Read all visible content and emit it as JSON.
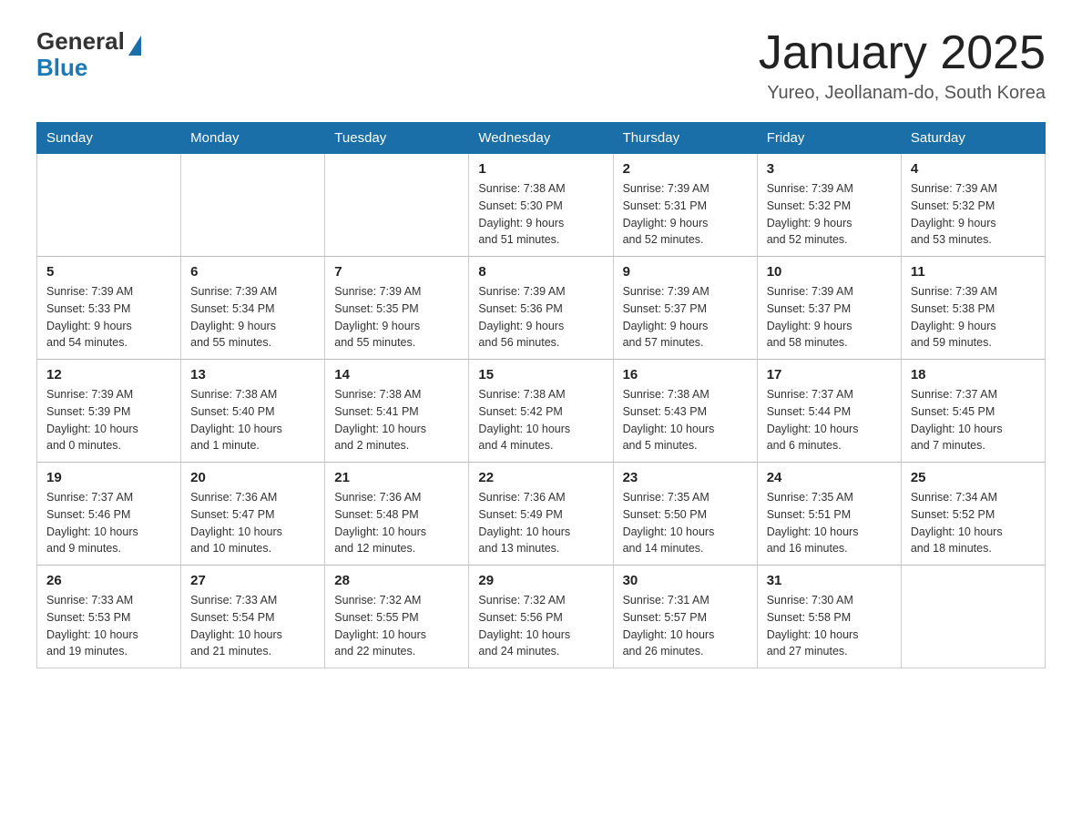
{
  "header": {
    "logo_general": "General",
    "logo_blue": "Blue",
    "title": "January 2025",
    "subtitle": "Yureo, Jeollanam-do, South Korea"
  },
  "weekdays": [
    "Sunday",
    "Monday",
    "Tuesday",
    "Wednesday",
    "Thursday",
    "Friday",
    "Saturday"
  ],
  "weeks": [
    [
      {
        "day": "",
        "info": ""
      },
      {
        "day": "",
        "info": ""
      },
      {
        "day": "",
        "info": ""
      },
      {
        "day": "1",
        "info": "Sunrise: 7:38 AM\nSunset: 5:30 PM\nDaylight: 9 hours\nand 51 minutes."
      },
      {
        "day": "2",
        "info": "Sunrise: 7:39 AM\nSunset: 5:31 PM\nDaylight: 9 hours\nand 52 minutes."
      },
      {
        "day": "3",
        "info": "Sunrise: 7:39 AM\nSunset: 5:32 PM\nDaylight: 9 hours\nand 52 minutes."
      },
      {
        "day": "4",
        "info": "Sunrise: 7:39 AM\nSunset: 5:32 PM\nDaylight: 9 hours\nand 53 minutes."
      }
    ],
    [
      {
        "day": "5",
        "info": "Sunrise: 7:39 AM\nSunset: 5:33 PM\nDaylight: 9 hours\nand 54 minutes."
      },
      {
        "day": "6",
        "info": "Sunrise: 7:39 AM\nSunset: 5:34 PM\nDaylight: 9 hours\nand 55 minutes."
      },
      {
        "day": "7",
        "info": "Sunrise: 7:39 AM\nSunset: 5:35 PM\nDaylight: 9 hours\nand 55 minutes."
      },
      {
        "day": "8",
        "info": "Sunrise: 7:39 AM\nSunset: 5:36 PM\nDaylight: 9 hours\nand 56 minutes."
      },
      {
        "day": "9",
        "info": "Sunrise: 7:39 AM\nSunset: 5:37 PM\nDaylight: 9 hours\nand 57 minutes."
      },
      {
        "day": "10",
        "info": "Sunrise: 7:39 AM\nSunset: 5:37 PM\nDaylight: 9 hours\nand 58 minutes."
      },
      {
        "day": "11",
        "info": "Sunrise: 7:39 AM\nSunset: 5:38 PM\nDaylight: 9 hours\nand 59 minutes."
      }
    ],
    [
      {
        "day": "12",
        "info": "Sunrise: 7:39 AM\nSunset: 5:39 PM\nDaylight: 10 hours\nand 0 minutes."
      },
      {
        "day": "13",
        "info": "Sunrise: 7:38 AM\nSunset: 5:40 PM\nDaylight: 10 hours\nand 1 minute."
      },
      {
        "day": "14",
        "info": "Sunrise: 7:38 AM\nSunset: 5:41 PM\nDaylight: 10 hours\nand 2 minutes."
      },
      {
        "day": "15",
        "info": "Sunrise: 7:38 AM\nSunset: 5:42 PM\nDaylight: 10 hours\nand 4 minutes."
      },
      {
        "day": "16",
        "info": "Sunrise: 7:38 AM\nSunset: 5:43 PM\nDaylight: 10 hours\nand 5 minutes."
      },
      {
        "day": "17",
        "info": "Sunrise: 7:37 AM\nSunset: 5:44 PM\nDaylight: 10 hours\nand 6 minutes."
      },
      {
        "day": "18",
        "info": "Sunrise: 7:37 AM\nSunset: 5:45 PM\nDaylight: 10 hours\nand 7 minutes."
      }
    ],
    [
      {
        "day": "19",
        "info": "Sunrise: 7:37 AM\nSunset: 5:46 PM\nDaylight: 10 hours\nand 9 minutes."
      },
      {
        "day": "20",
        "info": "Sunrise: 7:36 AM\nSunset: 5:47 PM\nDaylight: 10 hours\nand 10 minutes."
      },
      {
        "day": "21",
        "info": "Sunrise: 7:36 AM\nSunset: 5:48 PM\nDaylight: 10 hours\nand 12 minutes."
      },
      {
        "day": "22",
        "info": "Sunrise: 7:36 AM\nSunset: 5:49 PM\nDaylight: 10 hours\nand 13 minutes."
      },
      {
        "day": "23",
        "info": "Sunrise: 7:35 AM\nSunset: 5:50 PM\nDaylight: 10 hours\nand 14 minutes."
      },
      {
        "day": "24",
        "info": "Sunrise: 7:35 AM\nSunset: 5:51 PM\nDaylight: 10 hours\nand 16 minutes."
      },
      {
        "day": "25",
        "info": "Sunrise: 7:34 AM\nSunset: 5:52 PM\nDaylight: 10 hours\nand 18 minutes."
      }
    ],
    [
      {
        "day": "26",
        "info": "Sunrise: 7:33 AM\nSunset: 5:53 PM\nDaylight: 10 hours\nand 19 minutes."
      },
      {
        "day": "27",
        "info": "Sunrise: 7:33 AM\nSunset: 5:54 PM\nDaylight: 10 hours\nand 21 minutes."
      },
      {
        "day": "28",
        "info": "Sunrise: 7:32 AM\nSunset: 5:55 PM\nDaylight: 10 hours\nand 22 minutes."
      },
      {
        "day": "29",
        "info": "Sunrise: 7:32 AM\nSunset: 5:56 PM\nDaylight: 10 hours\nand 24 minutes."
      },
      {
        "day": "30",
        "info": "Sunrise: 7:31 AM\nSunset: 5:57 PM\nDaylight: 10 hours\nand 26 minutes."
      },
      {
        "day": "31",
        "info": "Sunrise: 7:30 AM\nSunset: 5:58 PM\nDaylight: 10 hours\nand 27 minutes."
      },
      {
        "day": "",
        "info": ""
      }
    ]
  ]
}
